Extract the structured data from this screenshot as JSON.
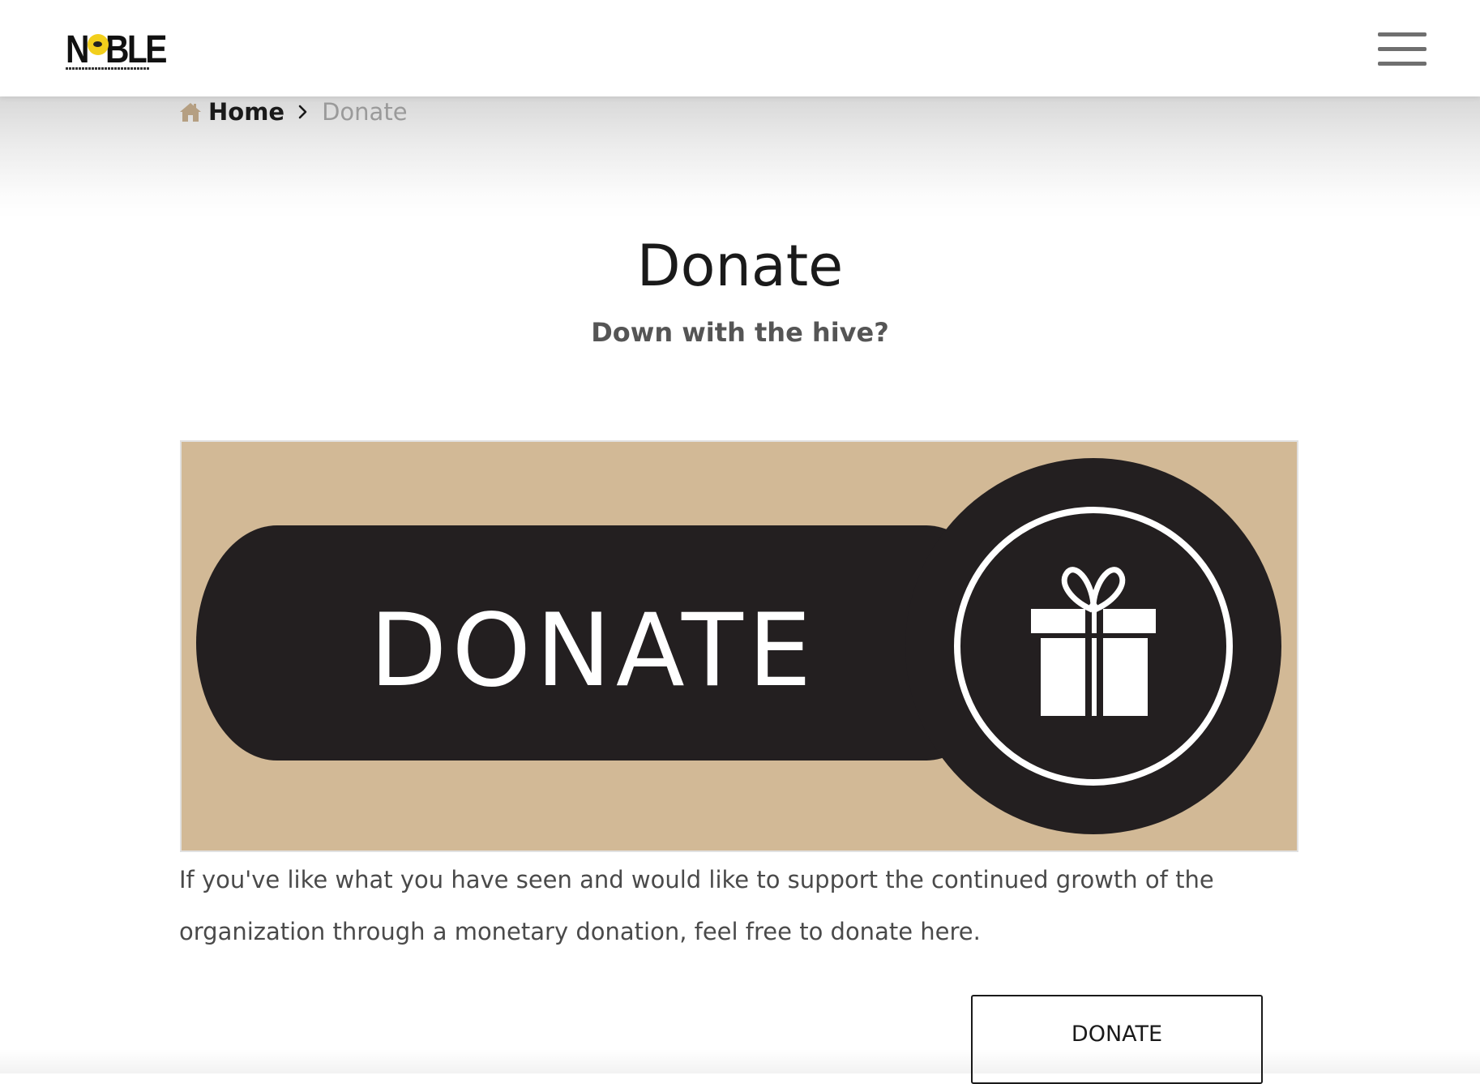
{
  "nav": {
    "logo_text": "NOBLE",
    "logo_left": "N",
    "logo_right": "BLE",
    "menu_icon": "hamburger-menu-icon"
  },
  "breadcrumb": {
    "home_icon": "home-icon",
    "home_label": "Home",
    "separator_icon": "chevron-right-icon",
    "current_label": "Donate"
  },
  "page": {
    "title": "Donate",
    "subtitle": "Down with the hive?"
  },
  "banner": {
    "text": "DONATE",
    "icon": "gift-icon",
    "colors": {
      "background": "#d2b996",
      "pill": "#231f20",
      "foreground": "#ffffff"
    }
  },
  "content": {
    "paragraph": "If you've like what you have seen and would like to support the continued growth of the organization through a monetary donation, feel free to donate here."
  },
  "cta": {
    "donate_label": "DONATE"
  }
}
